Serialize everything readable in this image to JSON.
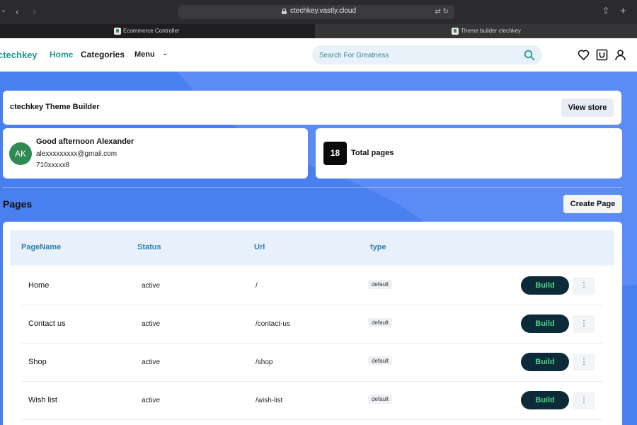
{
  "browser": {
    "url": "ctechkey.vastly.cloud",
    "tabs": [
      {
        "title": "Ecommerce Controller",
        "active": false
      },
      {
        "title": "Theme builder ctechkey",
        "active": true
      }
    ]
  },
  "header": {
    "logo": "ctechkey",
    "nav": {
      "home": "Home",
      "categories": "Categories",
      "menu": "Menu"
    },
    "search": {
      "placeholder": "Search For Greatness"
    }
  },
  "builder": {
    "title": "ctechkey Theme Builder",
    "view_store_label": "View store"
  },
  "user": {
    "initials": "AK",
    "greeting": "Good afternoon Alexander",
    "email": "alexxxxxxxxx@gmail.com",
    "phone": "710xxxxx8"
  },
  "stats": {
    "count": "18",
    "label": "Total pages"
  },
  "pages": {
    "heading": "Pages",
    "create_label": "Create Page",
    "columns": [
      "PageName",
      "Status",
      "Url",
      "type"
    ],
    "rows": [
      {
        "name": "Home",
        "status": "active",
        "url": "/",
        "type": "default",
        "action": "Build"
      },
      {
        "name": "Contact us",
        "status": "active",
        "url": "/contact-us",
        "type": "default",
        "action": "Build"
      },
      {
        "name": "Shop",
        "status": "active",
        "url": "/shop",
        "type": "default",
        "action": "Build"
      },
      {
        "name": "Wish list",
        "status": "active",
        "url": "/wish-list",
        "type": "default",
        "action": "Build"
      }
    ]
  },
  "colors": {
    "background": "#4a7ff0",
    "brand": "#1e9a8f",
    "build_button": "#0c2a38",
    "build_text": "#4fd18a",
    "avatar": "#2f8a54"
  },
  "icons": [
    "chevron-left-icon",
    "chevron-right-icon",
    "lock-icon",
    "translate-icon",
    "reload-icon",
    "share-icon",
    "plus-icon",
    "search-icon",
    "heart-icon",
    "cart-icon",
    "user-icon",
    "more-vertical-icon"
  ]
}
